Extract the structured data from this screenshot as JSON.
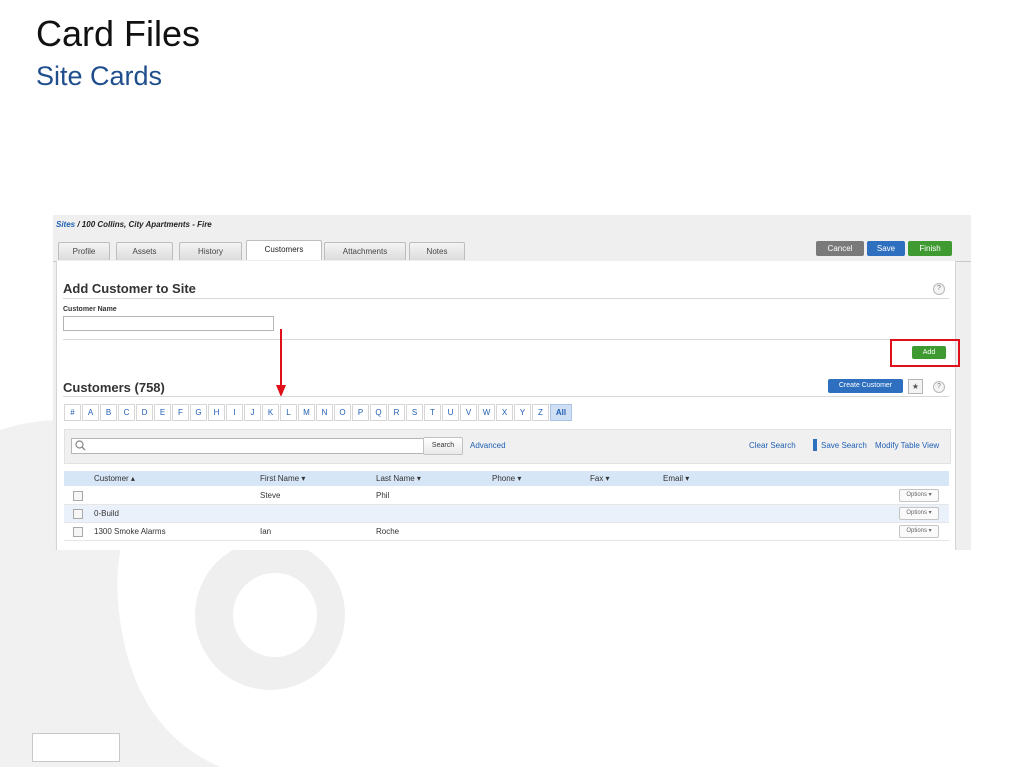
{
  "slide": {
    "title": "Card Files",
    "subtitle": "Site Cards"
  },
  "breadcrumb": {
    "link": "Sites",
    "sep": " / ",
    "current": "100 Collins, City Apartments - Fire"
  },
  "tabs": [
    "Profile",
    "Assets",
    "History",
    "Customers",
    "Attachments",
    "Notes"
  ],
  "active_tab": "Customers",
  "actions": {
    "cancel": "Cancel",
    "save": "Save",
    "finish": "Finish"
  },
  "add_section": {
    "heading": "Add Customer to Site",
    "field_label": "Customer Name",
    "field_value": "",
    "add_button": "Add",
    "help": "?"
  },
  "customers": {
    "heading": "Customers (758)",
    "create_button": "Create Customer",
    "star": "★",
    "help": "?",
    "letters": [
      "#",
      "A",
      "B",
      "C",
      "D",
      "E",
      "F",
      "G",
      "H",
      "I",
      "J",
      "K",
      "L",
      "M",
      "N",
      "O",
      "P",
      "Q",
      "R",
      "S",
      "T",
      "U",
      "V",
      "W",
      "X",
      "Y",
      "Z",
      "All"
    ],
    "selected_letter": "All"
  },
  "search": {
    "placeholder": "",
    "button": "Search",
    "advanced": "Advanced",
    "clear": "Clear Search",
    "save": "Save Search",
    "modify": "Modify Table View"
  },
  "table": {
    "columns": [
      "Customer ▴",
      "First Name ▾",
      "Last Name ▾",
      "Phone ▾",
      "Fax ▾",
      "Email ▾"
    ],
    "rows": [
      {
        "customer": "",
        "first": "Steve",
        "last": "Phil",
        "phone": "",
        "fax": "",
        "email": "",
        "options": "Options ▾"
      },
      {
        "customer": "0-Build",
        "first": "",
        "last": "",
        "phone": "",
        "fax": "",
        "email": "",
        "options": "Options ▾"
      },
      {
        "customer": "1300 Smoke Alarms",
        "first": "Ian",
        "last": "Roche",
        "phone": "",
        "fax": "",
        "email": "",
        "options": "Options ▾"
      }
    ]
  },
  "colors": {
    "title_blue": "#1f4e8c",
    "green": "#3f9a32",
    "blue": "#2f6fbf",
    "red": "#e0101a"
  }
}
